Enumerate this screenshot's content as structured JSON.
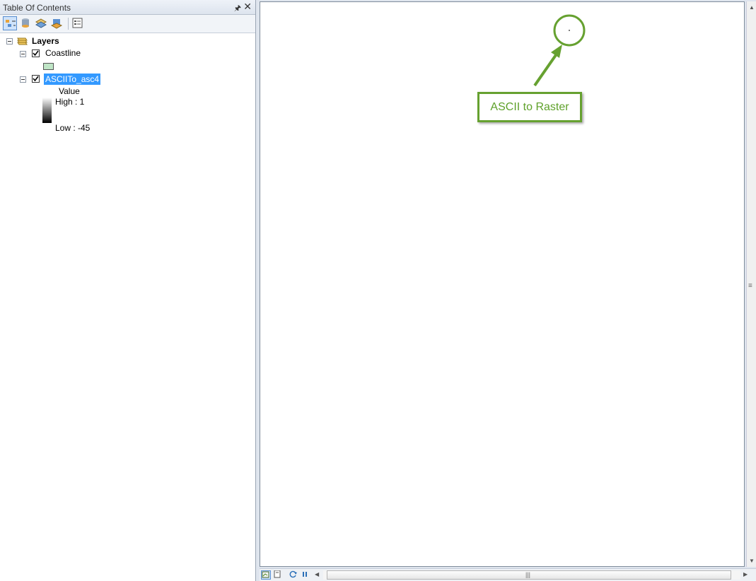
{
  "toc": {
    "title": "Table Of Contents",
    "pin_glyph": "¶",
    "close_glyph": "✕",
    "root_label": "Layers",
    "layers": [
      {
        "name": "Coastline",
        "checked": true,
        "symbol_color": "#bfe5c6"
      },
      {
        "name": "ASCIITo_asc4",
        "checked": true,
        "selected": true,
        "legend": {
          "field": "Value",
          "high": "High : 1",
          "low": "Low : -45"
        }
      }
    ]
  },
  "map": {
    "annotation_text": "ASCII to Raster",
    "annotation_color": "#66a130"
  },
  "scroll": {
    "grip": "|||",
    "vgrip": "≡"
  }
}
